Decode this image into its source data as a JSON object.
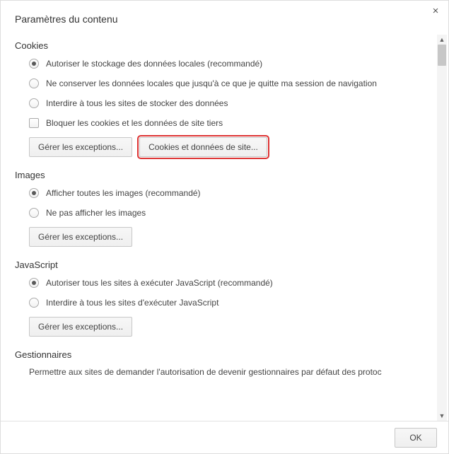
{
  "dialog": {
    "title": "Paramètres du contenu",
    "close_glyph": "×"
  },
  "sections": {
    "cookies": {
      "title": "Cookies",
      "opt1": "Autoriser le stockage des données locales (recommandé)",
      "opt2": "Ne conserver les données locales que jusqu'à ce que je quitte ma session de navigation",
      "opt3": "Interdire à tous les sites de stocker des données",
      "opt4": "Bloquer les cookies et les données de site tiers",
      "btn_exceptions": "Gérer les exceptions...",
      "btn_sitedata": "Cookies et données de site..."
    },
    "images": {
      "title": "Images",
      "opt1": "Afficher toutes les images (recommandé)",
      "opt2": "Ne pas afficher les images",
      "btn_exceptions": "Gérer les exceptions..."
    },
    "javascript": {
      "title": "JavaScript",
      "opt1": "Autoriser tous les sites à exécuter JavaScript (recommandé)",
      "opt2": "Interdire à tous les sites d'exécuter JavaScript",
      "btn_exceptions": "Gérer les exceptions..."
    },
    "handlers": {
      "title": "Gestionnaires",
      "truncated_option": "Permettre aux sites de demander l'autorisation de devenir gestionnaires par défaut des protoc"
    }
  },
  "footer": {
    "ok": "OK"
  }
}
